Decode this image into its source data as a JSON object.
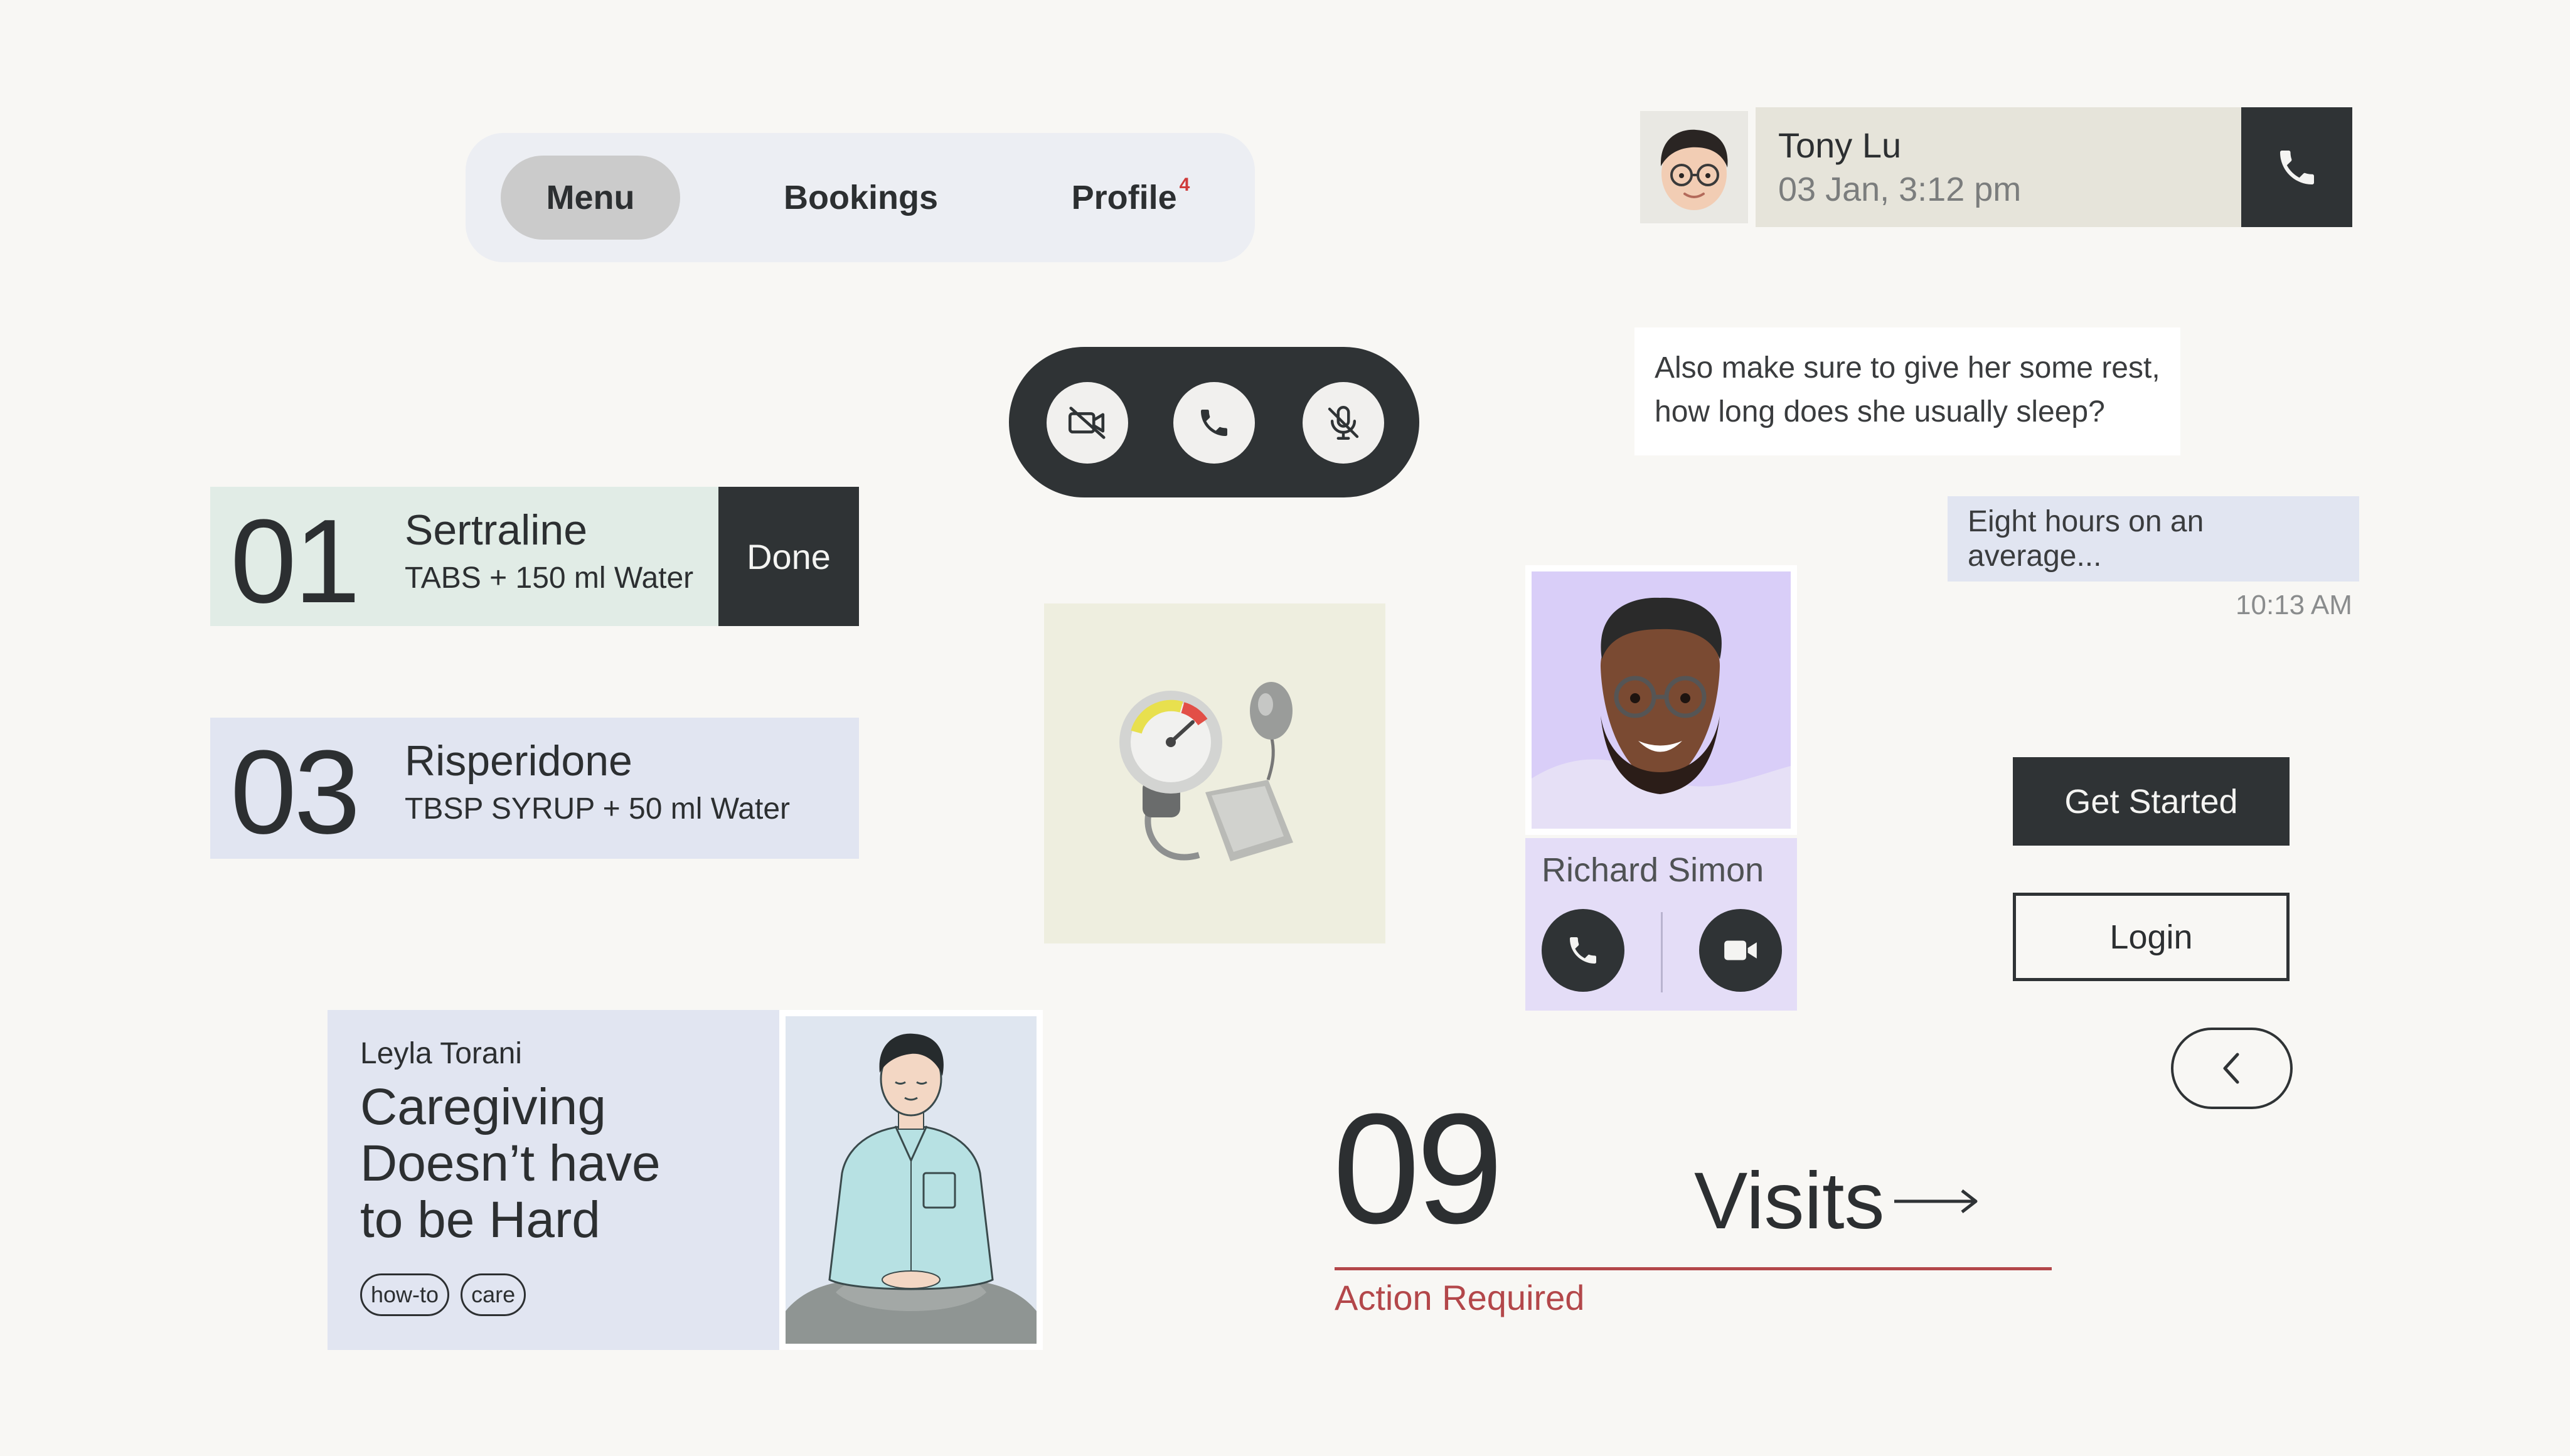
{
  "nav": {
    "tabs": [
      {
        "label": "Menu",
        "active": true
      },
      {
        "label": "Bookings"
      },
      {
        "label": "Profile",
        "badge": "4"
      }
    ]
  },
  "call_controls": {
    "icons": [
      "video-off-icon",
      "phone-icon",
      "mic-off-icon"
    ]
  },
  "contact": {
    "name": "Tony Lu",
    "datetime": "03 Jan, 3:12 pm",
    "call_icon": "phone-icon"
  },
  "chat": {
    "incoming_text": "Also make sure to give her some rest, how long does she usually sleep?",
    "outgoing_text": "Eight hours on an average...",
    "outgoing_time": "10:13 AM"
  },
  "medications": [
    {
      "number": "01",
      "name": "Sertraline",
      "dose": "TABS + 150 ml Water",
      "action": "Done"
    },
    {
      "number": "03",
      "name": "Risperidone",
      "dose": "TBSP SYRUP + 50 ml Water"
    }
  ],
  "doctor": {
    "name": "Richard Simon",
    "icons": [
      "phone-icon",
      "video-icon"
    ]
  },
  "buttons": {
    "get_started": "Get Started",
    "login": "Login",
    "back_icon": "chevron-left-icon"
  },
  "article": {
    "author": "Leyla Torani",
    "title": "Caregiving Doesn’t have to be Hard",
    "tags": [
      "how-to",
      "care"
    ]
  },
  "visits": {
    "count": "09",
    "label": "Visits",
    "note": "Action Required"
  },
  "colors": {
    "dark": "#2f3335",
    "background": "#f8f7f4",
    "alert": "#b3474a",
    "badge": "#cf3b3b"
  }
}
